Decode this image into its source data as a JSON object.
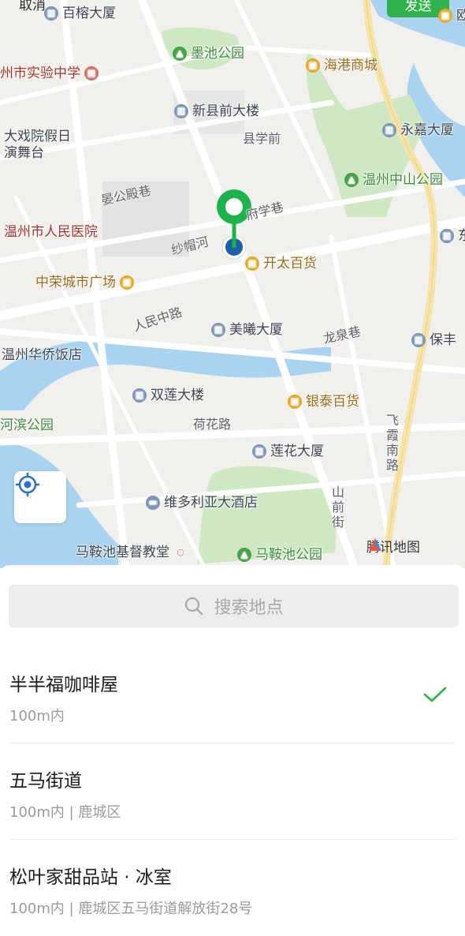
{
  "top": {
    "cancel_label": "取消",
    "send_label": "发送",
    "corner_poi": "欧"
  },
  "map": {
    "pois": [
      {
        "name": "百榕大厦",
        "icon": "building-icon"
      },
      {
        "name": "墨池公园",
        "icon": "park-icon"
      },
      {
        "name": "海港商城",
        "icon": "shopping-icon"
      },
      {
        "name": "州市实验中学",
        "icon": "school-icon"
      },
      {
        "name": "新县前大楼",
        "icon": "building-icon"
      },
      {
        "name": "永嘉大厦",
        "icon": "building-icon"
      },
      {
        "name": "大戏院假日\n演舞台",
        "icon": ""
      },
      {
        "name": "温州中山公园",
        "icon": "park-icon"
      },
      {
        "name": "温州市人民医院",
        "icon": ""
      },
      {
        "name": "开太百货",
        "icon": "shopping-icon"
      },
      {
        "name": "中荣城市广场",
        "icon": "shopping-icon"
      },
      {
        "name": "美曦大厦",
        "icon": "building-icon"
      },
      {
        "name": "保丰",
        "icon": "building-icon"
      },
      {
        "name": "温州华侨饭店",
        "icon": ""
      },
      {
        "name": "双莲大楼",
        "icon": "building-icon"
      },
      {
        "name": "银泰百货",
        "icon": "shopping-icon"
      },
      {
        "name": "河滨公园",
        "icon": ""
      },
      {
        "name": "莲花大厦",
        "icon": "building-icon"
      },
      {
        "name": "维多利亚大酒店",
        "icon": "hotel-icon"
      },
      {
        "name": "马鞍池基督教堂",
        "icon": "church-icon"
      },
      {
        "name": "马鞍池公园",
        "icon": "park-icon"
      },
      {
        "name": "东",
        "icon": "building-icon"
      }
    ],
    "roads": [
      "县学前",
      "晏公殿巷",
      "府学巷",
      "纱帽河",
      "人民中路",
      "龙泉巷",
      "荷花路",
      "飞霞南路",
      "山前街"
    ],
    "brand": "腾讯地图",
    "colors": {
      "pin": "#1db34a",
      "dot": "#1a5fa8",
      "accent": "#2fb24c"
    }
  },
  "search": {
    "placeholder": "搜索地点"
  },
  "places": [
    {
      "name": "半半福咖啡屋",
      "detail": "100m内",
      "selected": true
    },
    {
      "name": "五马街道",
      "detail": "100m内 | 鹿城区",
      "selected": false
    },
    {
      "name": "松叶家甜品站 · 冰室",
      "detail": "100m内 | 鹿城区五马街道解放街28号",
      "selected": false
    }
  ]
}
